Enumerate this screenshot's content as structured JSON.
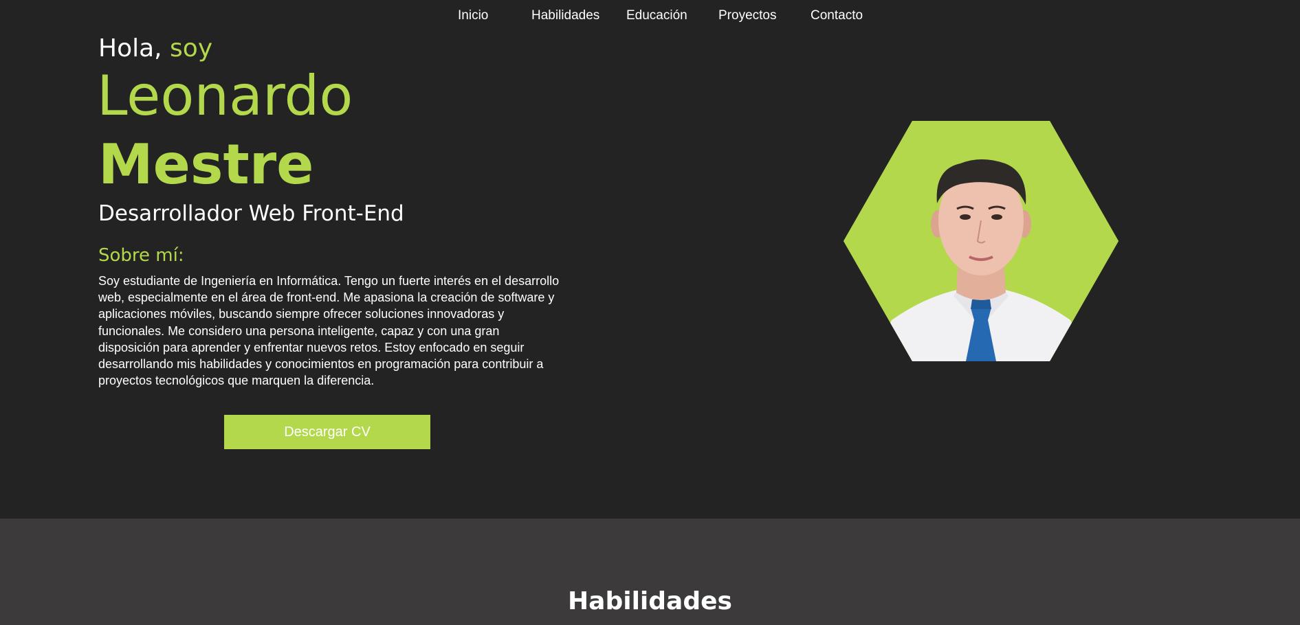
{
  "nav": {
    "items": [
      {
        "label": "Inicio"
      },
      {
        "label": "Habilidades"
      },
      {
        "label": "Educación"
      },
      {
        "label": "Proyectos"
      },
      {
        "label": "Contacto"
      }
    ]
  },
  "hero": {
    "greeting_prefix": "Hola, ",
    "greeting_accent": "soy",
    "first_name": "Leonardo",
    "last_name": "Mestre",
    "role": "Desarrollador Web Front-End",
    "about_title": "Sobre mí:",
    "about_text": "Soy estudiante de Ingeniería en Informática. Tengo un fuerte interés en el desarrollo web, especialmente en el área de front-end. Me apasiona la creación de software y aplicaciones móviles, buscando siempre ofrecer soluciones innovadoras y funcionales. Me considero una persona inteligente, capaz y con una gran disposición para aprender y enfrentar nuevos retos. Estoy enfocado en seguir desarrollando mis habilidades y conocimientos en programación para contribuir a proyectos tecnológicos que marquen la diferencia.",
    "cv_button": "Descargar CV"
  },
  "skills": {
    "title": "Habilidades"
  },
  "colors": {
    "accent": "#b3d84c",
    "background": "#232323",
    "section_alt": "#3c3a3b",
    "text": "#ffffff"
  }
}
